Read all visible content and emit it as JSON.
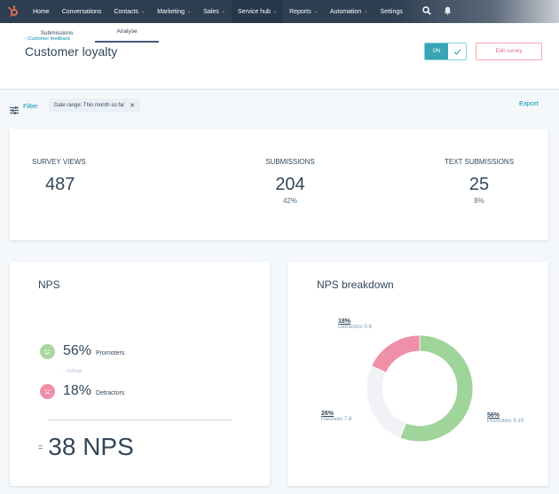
{
  "nav": {
    "items": [
      {
        "label": "Home",
        "has_menu": false
      },
      {
        "label": "Conversations",
        "has_menu": false
      },
      {
        "label": "Contacts",
        "has_menu": true
      },
      {
        "label": "Marketing",
        "has_menu": true
      },
      {
        "label": "Sales",
        "has_menu": true
      },
      {
        "label": "Service hub",
        "has_menu": true,
        "active": true
      },
      {
        "label": "Reports",
        "has_menu": true
      },
      {
        "label": "Automation",
        "has_menu": true
      },
      {
        "label": "Settings",
        "has_menu": false
      }
    ],
    "chevron": "⌄",
    "icons": [
      "search-icon",
      "notifications-bell-icon"
    ]
  },
  "header": {
    "breadcrumb": "‹ Customer feedback",
    "title": "Customer loyalty",
    "toggle_label": "ON",
    "toggle_state": true,
    "edit_button": "Edit survey",
    "tabs": [
      {
        "label": "Submissions",
        "active": false
      },
      {
        "label": "Analyse",
        "active": true
      }
    ]
  },
  "filter": {
    "label": "Filter",
    "chip": "Date range: This month so far",
    "chip_close": "✕",
    "export": "Export"
  },
  "stats": [
    {
      "label": "SURVEY VIEWS",
      "value": "487",
      "pct": ""
    },
    {
      "label": "SUBMISSIONS",
      "value": "204",
      "pct": "42%"
    },
    {
      "label": "TEXT SUBMISSIONS",
      "value": "25",
      "pct": "8%"
    }
  ],
  "nps": {
    "title": "NPS",
    "promoters_pct": "56%",
    "promoters_label": "Promoters",
    "minus": "- minus",
    "detractors_pct": "18%",
    "detractors_label": "Detractors",
    "equals": "=",
    "score": "38 NPS"
  },
  "colors": {
    "promoters": "#9fd49a",
    "passives": "#f0f2f5",
    "detractors": "#ef8fa8",
    "accent": "#0091ae",
    "nav_bg": "#2d3e50"
  },
  "chart_data": {
    "type": "pie",
    "title": "NPS breakdown",
    "donut": true,
    "categories": [
      "Promoters 9-10",
      "Passives 7-8",
      "Detractors 0-6"
    ],
    "values": [
      56,
      26,
      18
    ],
    "labels": [
      "56%",
      "26%",
      "18%"
    ],
    "colors": [
      "#9fd49a",
      "#f0f2f5",
      "#ef8fa8"
    ],
    "start": "top",
    "direction": "clockwise"
  }
}
